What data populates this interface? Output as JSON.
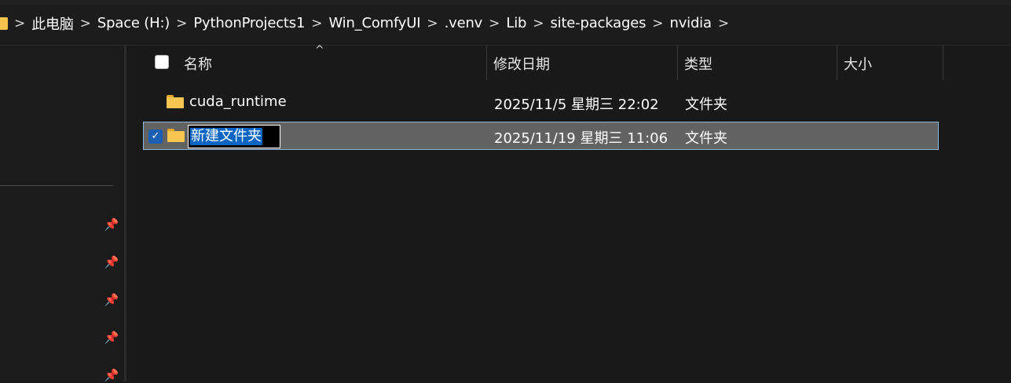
{
  "breadcrumb": {
    "items": [
      "此电脑",
      "Space (H:)",
      "PythonProjects1",
      "Win_ComfyUI",
      ".venv",
      "Lib",
      "site-packages",
      "nvidia"
    ],
    "separator": ">"
  },
  "columns": {
    "name": "名称",
    "modified": "修改日期",
    "type": "类型",
    "size": "大小"
  },
  "rows": [
    {
      "name": "cuda_runtime",
      "modified": "2025/11/5 星期三 22:02",
      "type": "文件夹",
      "size": ""
    },
    {
      "name": "新建文件夹",
      "modified": "2025/11/19 星期三 11:06",
      "type": "文件夹",
      "size": "",
      "renaming": true
    }
  ],
  "colors": {
    "folder": "#f6c650",
    "accent": "#0a66c2",
    "selected_row": "#626262"
  }
}
